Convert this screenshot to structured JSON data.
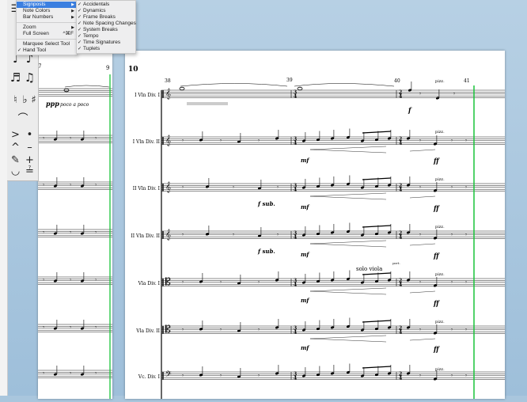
{
  "view_menu": {
    "items": [
      {
        "label": "Signposts",
        "check": "",
        "arrow": "▶",
        "shortcut": "",
        "highlighted": true
      },
      {
        "label": "Note Colors",
        "check": "",
        "arrow": "▶",
        "shortcut": "",
        "highlighted": false
      },
      {
        "label": "Bar Numbers",
        "check": "",
        "arrow": "▶",
        "shortcut": "",
        "highlighted": false
      },
      {
        "label": "Zoom",
        "check": "",
        "arrow": "▶",
        "shortcut": "",
        "highlighted": false
      },
      {
        "label": "Full Screen",
        "check": "",
        "arrow": "",
        "shortcut": "^⌘F",
        "highlighted": false
      },
      {
        "label": "Marquee Select Tool",
        "check": "",
        "arrow": "",
        "shortcut": "",
        "highlighted": false
      },
      {
        "label": "Hand Tool",
        "check": "✓",
        "arrow": "",
        "shortcut": "",
        "highlighted": false
      }
    ]
  },
  "signposts_submenu": {
    "items": [
      {
        "label": "Accidentals",
        "check": "✓"
      },
      {
        "label": "Dynamics",
        "check": "✓"
      },
      {
        "label": "Frame Breaks",
        "check": "✓"
      },
      {
        "label": "Note Spacing Changes",
        "check": "✓"
      },
      {
        "label": "System Breaks",
        "check": "✓"
      },
      {
        "label": "Tempo",
        "check": "✓"
      },
      {
        "label": "Time Signatures",
        "check": "✓"
      },
      {
        "label": "Tuplets",
        "check": "✓"
      }
    ]
  },
  "left_page": {
    "bar_start": "7",
    "bar_end": "9",
    "dynamic": "ppp",
    "expression": "poco a poco"
  },
  "right_page": {
    "page_number": "10",
    "bar_numbers": [
      "38",
      "39",
      "40",
      "41"
    ],
    "staves": [
      {
        "name": "I Vln Div. I"
      },
      {
        "name": "I Vln Div. II"
      },
      {
        "name": "II Vln Div. I"
      },
      {
        "name": "II Vln Div. II"
      },
      {
        "name": "Vla Div. I"
      },
      {
        "name": "Vla Div. II"
      },
      {
        "name": "Vc. Div. I"
      }
    ],
    "texts": {
      "pizz": "pizz.",
      "f": "f",
      "ff": "ff",
      "mf": "mf",
      "fsub": "f sub.",
      "solo": "solo viola",
      "port": "port."
    },
    "time_sig_3": "3",
    "time_sig_4": "4",
    "time_sig_2": "2"
  },
  "palette": {
    "icons": [
      "quarter-note-icon",
      "eighth-note-icon",
      "sixteenth-note-icon",
      "dotted-icon",
      "natural-icon",
      "flat-icon",
      "sharp-icon",
      "slur-icon",
      "accent-icon",
      "staccato-icon",
      "marcato-icon",
      "tenuto-icon",
      "fermata-icon"
    ]
  },
  "colors": {
    "selection_line": "#19c33a",
    "menu_highlight": "#3b7fe0"
  }
}
